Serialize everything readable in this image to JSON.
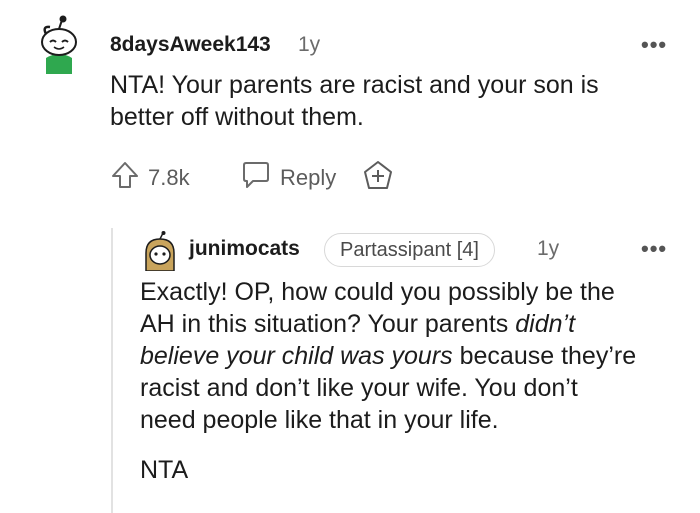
{
  "comment": {
    "username": "8daysAweek143",
    "age": "1y",
    "more": "•••",
    "body": [
      "NTA! Your parents are racist and your son is",
      "better off without them."
    ],
    "upvotes": "7.8k",
    "reply_label": "Reply",
    "avatar_icon": "snoo-avatar-green-shirt-icon"
  },
  "reply": {
    "username": "junimocats",
    "flair": "Partassipant [4]",
    "age": "1y",
    "more": "•••",
    "lines": [
      "Exactly! OP, how could you possibly be the",
      "AH in this situation? Your parents",
      "didn’t",
      "believe your child was yours",
      "because they’re",
      "racist and don’t like your wife. You don’t",
      "need people like that in your life."
    ],
    "signoff": "NTA",
    "avatar_icon": "snoo-avatar-long-hair-icon"
  },
  "colors": {
    "shirt": "#2fa84f",
    "text": "#1c1c1c",
    "meta": "#6b6b6b",
    "thread": "#e2e2e2"
  }
}
